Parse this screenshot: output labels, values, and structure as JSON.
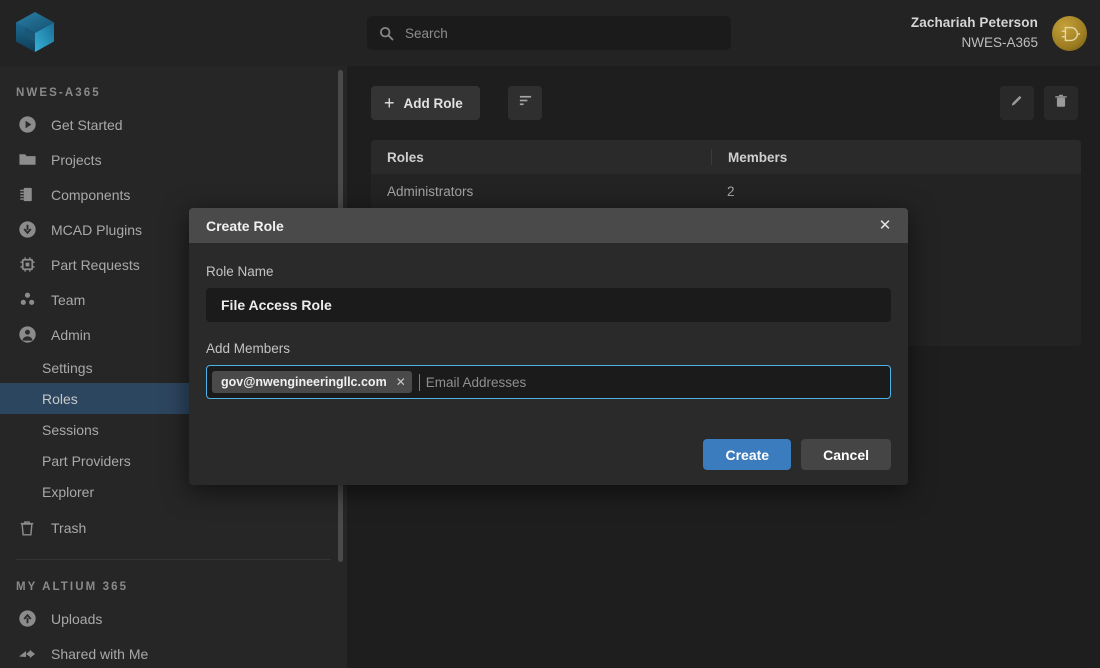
{
  "topbar": {
    "logo_icon": "altium-cube-logo",
    "search": {
      "icon": "search-icon",
      "value": "",
      "placeholder": "Search"
    },
    "user": {
      "name": "Zachariah Peterson",
      "org": "NWES-A365",
      "avatar_icon": "logic-gate-avatar"
    }
  },
  "sidebar": {
    "workspace_title": "NWES-A365",
    "items": [
      {
        "label": "Get Started",
        "icon": "play-circle-icon"
      },
      {
        "label": "Projects",
        "icon": "folder-icon"
      },
      {
        "label": "Components",
        "icon": "chip-icon"
      },
      {
        "label": "MCAD Plugins",
        "icon": "download-circle-icon"
      },
      {
        "label": "Part Requests",
        "icon": "part-chip-icon"
      },
      {
        "label": "Team",
        "icon": "team-icon"
      },
      {
        "label": "Admin",
        "icon": "person-circle-icon"
      }
    ],
    "admin_subitems": [
      {
        "label": "Settings",
        "active": false
      },
      {
        "label": "Roles",
        "active": true
      },
      {
        "label": "Sessions",
        "active": false
      },
      {
        "label": "Part Providers",
        "active": false
      },
      {
        "label": "Explorer",
        "active": false
      }
    ],
    "trash": {
      "label": "Trash",
      "icon": "trash-icon"
    },
    "my_section_title": "MY ALTIUM 365",
    "my_items": [
      {
        "label": "Uploads",
        "icon": "upload-circle-icon"
      },
      {
        "label": "Shared with Me",
        "icon": "share-arrows-icon"
      }
    ]
  },
  "main": {
    "toolbar": {
      "add_role_label": "Add Role",
      "add_icon": "plus-icon",
      "sort_icon": "sort-filter-icon",
      "edit_icon": "pencil-icon",
      "delete_icon": "trash-icon"
    },
    "table": {
      "columns": [
        "Roles",
        "Members"
      ],
      "rows": [
        {
          "role": "Administrators",
          "members": "2"
        }
      ]
    }
  },
  "modal": {
    "title": "Create Role",
    "close_icon": "close-icon",
    "role_name_label": "Role Name",
    "role_name_value": "File Access Role",
    "role_name_placeholder": "Role Name",
    "add_members_label": "Add Members",
    "member_chips": [
      {
        "email": "gov@nwengineeringllc.com",
        "remove_icon": "close-icon"
      }
    ],
    "email_input_value": "",
    "email_input_placeholder": "Email Addresses",
    "create_label": "Create",
    "cancel_label": "Cancel"
  },
  "colors": {
    "accent_blue": "#3a7cbd",
    "focus_border": "#4db2e8",
    "active_nav": "#2d4660",
    "avatar_gold": "#9d7d22"
  }
}
